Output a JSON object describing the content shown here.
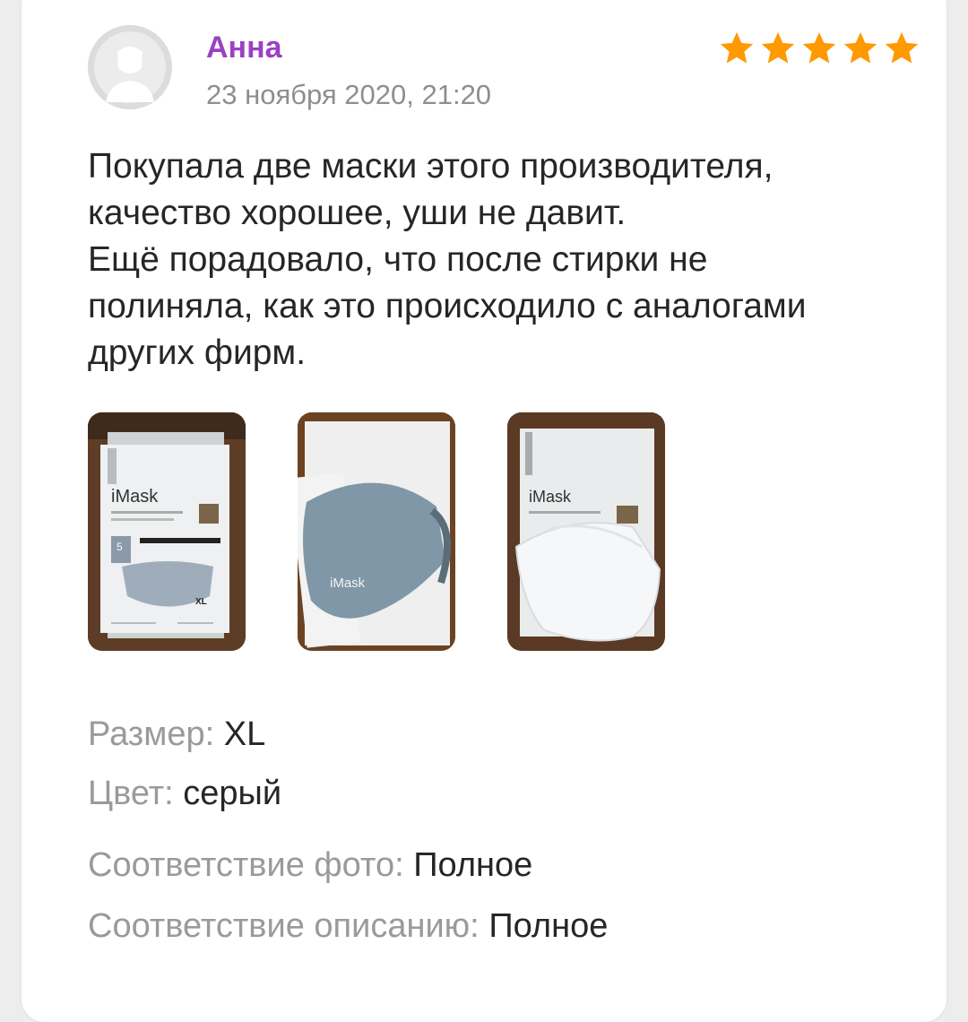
{
  "review": {
    "author": "Анна",
    "date": "23 ноября 2020, 21:20",
    "rating": 5,
    "star_color": "#ff9900",
    "author_color": "#9b40c4",
    "text": "Покупала две маски этого производителя,\nкачество хорошее, уши не давит.\nЕщё порадовало, что после стирки не\nполиняла, как это происходило с аналогами\nдругих фирм.",
    "photos": [
      {
        "brand": "iMask",
        "size_label": "XL",
        "count": "5"
      },
      {
        "brand": "iMask"
      },
      {
        "brand": "iMask"
      }
    ],
    "attributes": {
      "size": {
        "label": "Размер:",
        "value": "XL"
      },
      "color": {
        "label": "Цвет:",
        "value": "серый"
      },
      "photo_match": {
        "label": "Соответствие фото:",
        "value": "Полное"
      },
      "description_match": {
        "label": "Соответствие описанию:",
        "value": "Полное"
      }
    }
  }
}
